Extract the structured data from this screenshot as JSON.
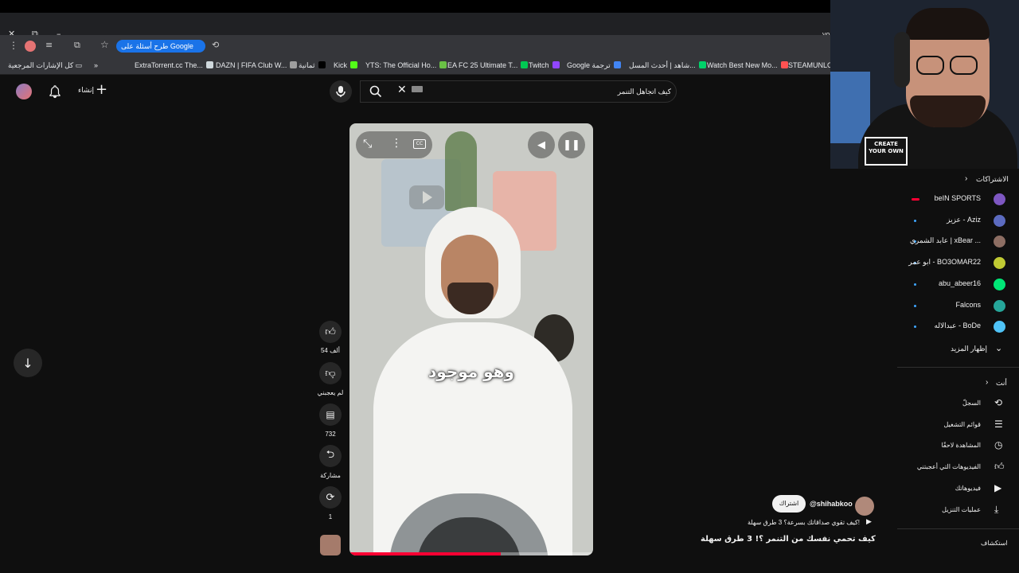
{
  "browser": {
    "omnibox_chip": "طرح أسئلة على Google",
    "url_fragment": "yo",
    "all_bookmarks": "كل الإشارات المرجعية",
    "bookmarks": [
      {
        "label": "ExtraTorrent.cc The...",
        "color": "#cfd8dc"
      },
      {
        "label": "DAZN | FIFA Club W...",
        "color": "#9e9e9e"
      },
      {
        "label": "ثمانية",
        "color": "#000000"
      },
      {
        "label": "Kick",
        "color": "#53fc18"
      },
      {
        "label": "YTS: The Official Ho...",
        "color": "#6ac045"
      },
      {
        "label": "EA FC 25 Ultimate T...",
        "color": "#00c853"
      },
      {
        "label": "Twitch",
        "color": "#9146ff"
      },
      {
        "label": "Google ترجمة",
        "color": "#4285f4"
      },
      {
        "label": "شاهد | أحدث المسل...",
        "color": "#00d26a"
      },
      {
        "label": "Watch Best New Mo...",
        "color": "#ff5252"
      },
      {
        "label": "STEAMUNLOCK",
        "color": "#eceff1"
      }
    ]
  },
  "header": {
    "create_label": "إنشاء",
    "search_value": "كيف اتجاهل التنمر"
  },
  "video": {
    "caption": "وهو موجود",
    "likes": "54 ألف",
    "dislike_label": "لم يعجبني",
    "comments": "732",
    "share_label": "مشاركة",
    "remix_count": "1",
    "channel_handle": "@shihabkoo",
    "subscribe_label": "اشتراك",
    "related_label": "كيف تقوي صداقاتك بسرعة؟ 3 طرق سهلة!",
    "title": "كيف تحمي نفسك من التنمر ؟! 3 طرق سهلة",
    "progress": 0.62
  },
  "sidebar": {
    "subscriptions_title": "الاشتراكات",
    "channels": [
      {
        "name": "beIN SPORTS",
        "color": "#7e57c2",
        "live": true
      },
      {
        "name": "عزيز - Aziz",
        "color": "#5c6bc0",
        "live": false
      },
      {
        "name": "عابد الشمري | xBear ...",
        "color": "#8d6e63",
        "live": false
      },
      {
        "name": "ابو عمر - BO3OMAR22",
        "color": "#c0ca33",
        "live": false
      },
      {
        "name": "abu_abeer16",
        "color": "#00e676",
        "live": false
      },
      {
        "name": "Falcons",
        "color": "#26a69a",
        "live": false
      },
      {
        "name": "عبدالاله - BoDe",
        "color": "#4fc3f7",
        "live": false
      }
    ],
    "show_more": "إظهار المزيد",
    "you_title": "أنت",
    "you_items": [
      {
        "label": "السجلّ",
        "icon": "history-icon"
      },
      {
        "label": "قوائم التشغيل",
        "icon": "playlist-icon"
      },
      {
        "label": "المشاهدة لاحقًا",
        "icon": "clock-icon"
      },
      {
        "label": "الفيديوهات التي أعجبتني",
        "icon": "thumb-up-icon"
      },
      {
        "label": "فيديوهاتك",
        "icon": "video-icon"
      },
      {
        "label": "عمليات التنزيل",
        "icon": "download-icon"
      }
    ],
    "explore_title": "استكشاف"
  },
  "webcam": {
    "hoodie_text": "CREATE YOUR OWN"
  }
}
